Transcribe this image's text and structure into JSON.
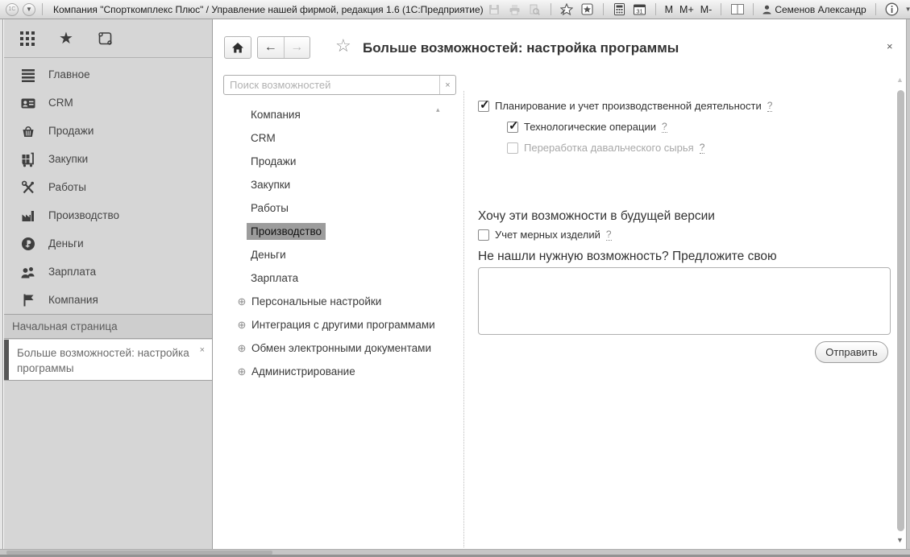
{
  "titlebar": {
    "logo": "1С",
    "title": "Компания \"Спорткомплекс Плюс\" / Управление нашей фирмой, редакция 1.6  (1С:Предприятие)",
    "memory": [
      "M",
      "M+",
      "M-"
    ],
    "user_name": "Семенов Александр"
  },
  "sidebar": {
    "menu": [
      {
        "icon": "main-lines-icon",
        "label": "Главное"
      },
      {
        "icon": "contact-card-icon",
        "label": "CRM"
      },
      {
        "icon": "basket-icon",
        "label": "Продажи"
      },
      {
        "icon": "cart-icon",
        "label": "Закупки"
      },
      {
        "icon": "tools-icon",
        "label": "Работы"
      },
      {
        "icon": "factory-icon",
        "label": "Производство"
      },
      {
        "icon": "ruble-coin-icon",
        "label": "Деньги"
      },
      {
        "icon": "people-icon",
        "label": "Зарплата"
      },
      {
        "icon": "flag-icon",
        "label": "Компания"
      }
    ],
    "home_tab": "Начальная страница",
    "active_tab": "Больше возможностей: настройка программы",
    "tab_close": "×"
  },
  "content": {
    "page_title": "Больше возможностей: настройка программы",
    "close": "×",
    "nav": {
      "back": "←",
      "forward": "→",
      "favorite_star": "☆"
    },
    "search": {
      "placeholder": "Поиск возможностей",
      "clear": "×"
    },
    "collapse_arrow": "▴",
    "categories": [
      "Компания",
      "CRM",
      "Продажи",
      "Закупки",
      "Работы",
      "Производство",
      "Деньги",
      "Зарплата"
    ],
    "selected_category": "Производство",
    "expand_glyph": "⊕",
    "expandable_categories": [
      "Персональные настройки",
      "Интеграция с другими программами",
      "Обмен электронными документами",
      "Администрирование"
    ],
    "settings": {
      "checkboxes": [
        {
          "label": "Планирование и учет производственной деятельности",
          "help": "?",
          "checked": true,
          "enabled": true
        },
        {
          "label": "Технологические операции",
          "help": "?",
          "checked": true,
          "enabled": true
        },
        {
          "label": "Переработка давальческого сырья",
          "help": "?",
          "checked": false,
          "enabled": false
        }
      ],
      "future_header": "Хочу эти возможности в будущей версии",
      "future_checkbox": {
        "label": "Учет мерных изделий",
        "help": "?",
        "checked": false
      },
      "suggest_header": "Не нашли нужную возможность? Предложите свою",
      "suggestion_value": "",
      "send_button": "Отправить"
    },
    "scrollbar": {
      "up": "▲",
      "down": "▼"
    }
  }
}
